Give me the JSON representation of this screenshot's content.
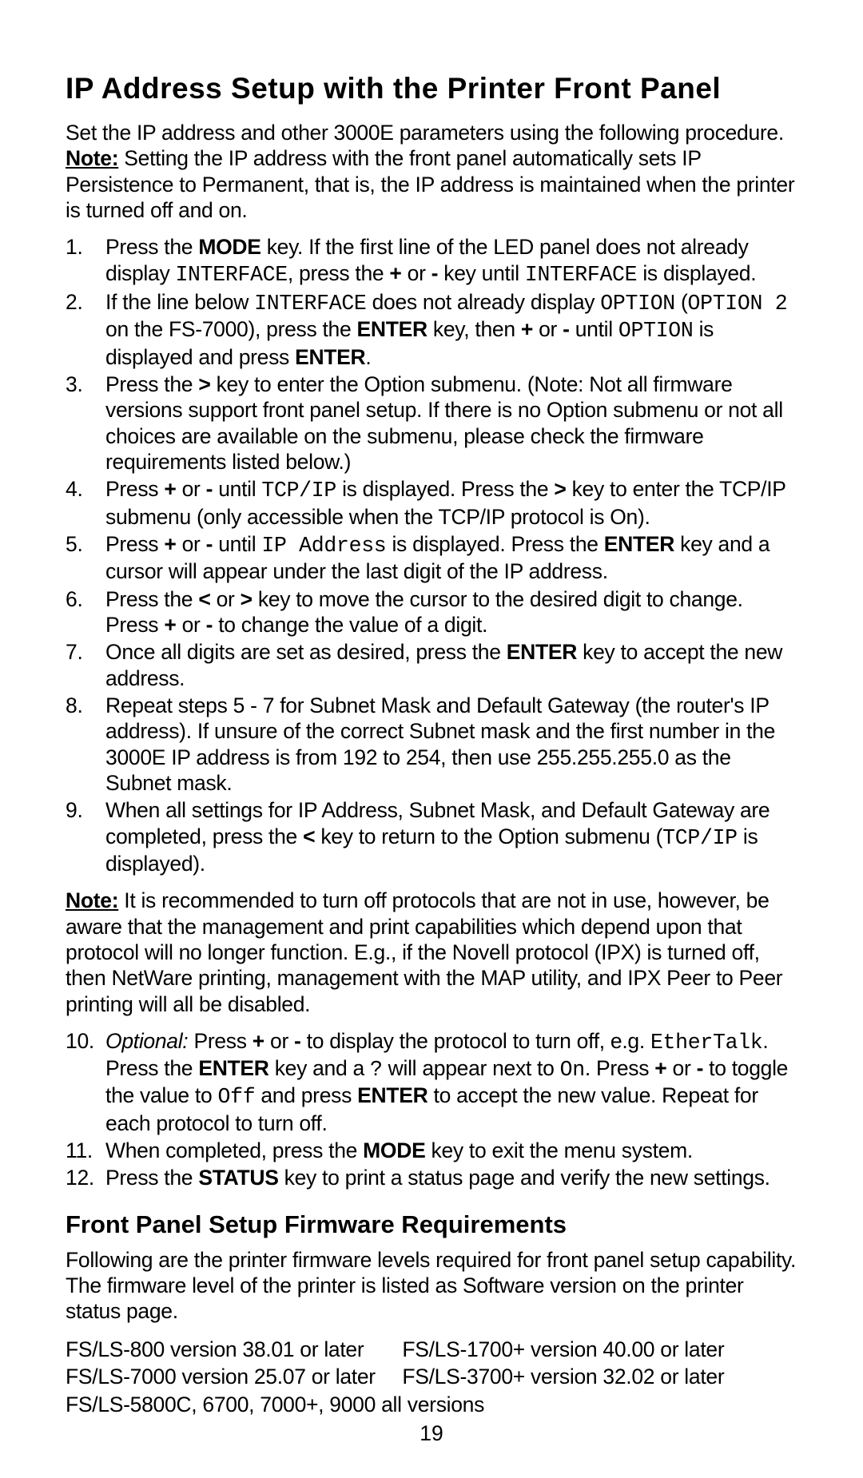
{
  "title": "IP Address Setup with the Printer Front Panel",
  "intro_line1": "Set the IP address and other 3000E parameters using the following procedure.",
  "intro_note_label": "Note:",
  "intro_note_text": " Setting the IP address with the front panel automatically sets IP Persistence to Permanent, that is, the IP address is maintained when the printer is turned off and on.",
  "step1_a": "Press the ",
  "step1_mode": "MODE",
  "step1_b": " key. If the first line of the LED panel does not already display ",
  "step1_interface1": "INTERFACE",
  "step1_c": ", press the ",
  "step1_plus": "+",
  "step1_d": " or ",
  "step1_minus": "-",
  "step1_e": " key until ",
  "step1_interface2": "INTERFACE",
  "step1_f": " is displayed.",
  "step2_a": "If the line below ",
  "step2_interface": "INTERFACE",
  "step2_b": " does not already display ",
  "step2_option1": "OPTION",
  "step2_c": " (",
  "step2_option2": "OPTION 2",
  "step2_d": " on the FS-7000), press the ",
  "step2_enter1": "ENTER",
  "step2_e": " key, then ",
  "step2_plus": "+",
  "step2_f": " or ",
  "step2_minus": "-",
  "step2_g": " until ",
  "step2_option3": "OPTION",
  "step2_h": " is displayed and press ",
  "step2_enter2": "ENTER",
  "step2_i": ".",
  "step3_a": "Press the ",
  "step3_gt": ">",
  "step3_b": " key to enter the Option submenu. (Note: Not all firmware versions support front panel setup. If there is no Option submenu or not all choices are available on the submenu, please check the firmware requirements listed below.)",
  "step4_a": "Press ",
  "step4_plus": "+",
  "step4_b": " or ",
  "step4_minus": "-",
  "step4_c": " until ",
  "step4_tcpip": "TCP/IP",
  "step4_d": " is displayed. Press the ",
  "step4_gt": ">",
  "step4_e": " key to enter the TCP/IP submenu (only accessible when the TCP/IP protocol is On).",
  "step5_a": "Press ",
  "step5_plus": "+",
  "step5_b": " or ",
  "step5_minus": "-",
  "step5_c": " until ",
  "step5_ipaddr": "IP Address",
  "step5_d": " is displayed. Press the ",
  "step5_enter": "ENTER",
  "step5_e": " key and a cursor will appear under the last digit of the IP address.",
  "step6_a": "Press the ",
  "step6_lt": "<",
  "step6_b": " or ",
  "step6_gt": ">",
  "step6_c": " key to move the cursor to the desired digit to change. Press ",
  "step6_plus": "+",
  "step6_d": " or ",
  "step6_minus": "-",
  "step6_e": " to change the value of a digit.",
  "step7_a": "Once all digits are set as desired, press the ",
  "step7_enter": "ENTER",
  "step7_b": " key to accept the new address.",
  "step8_a": "Repeat steps 5 - 7 for Subnet Mask and Default Gateway (the router's IP address). If unsure of the correct Subnet mask and the first number in the 3000E IP address is from 192 to 254, then use 255.255.255.0 as the Subnet mask.",
  "step9_a": "When all settings for IP Address, Subnet Mask, and Default Gateway are completed, press the ",
  "step9_lt": "<",
  "step9_b": " key to return to the Option submenu (",
  "step9_tcpip": "TCP/IP",
  "step9_c": " is displayed).",
  "mid_note_label": "Note:",
  "mid_note_text": " It is recommended to turn off protocols that are not in use, however, be aware that the management and print capabilities which depend upon that protocol will no longer function. E.g., if the Novell protocol (IPX) is turned off, then NetWare printing, management with the MAP utility, and IPX Peer to Peer printing will all be disabled.",
  "step10_opt": "Optional:",
  "step10_a": " Press ",
  "step10_plus": "+",
  "step10_b": " or ",
  "step10_minus": "-",
  "step10_c": " to display the protocol to turn off, e.g. ",
  "step10_ethertalk": "EtherTalk",
  "step10_d": ". Press the ",
  "step10_enter1": "ENTER",
  "step10_e": " key and a ",
  "step10_q": "?",
  "step10_f": " will appear next to ",
  "step10_on": "On",
  "step10_g": ". Press ",
  "step10_plus2": "+",
  "step10_h": " or ",
  "step10_minus2": "-",
  "step10_i": " to toggle the value to ",
  "step10_off": "Off",
  "step10_j": " and press ",
  "step10_enter2": "ENTER",
  "step10_k": " to accept the new value. Repeat for each protocol to turn off.",
  "step11_a": "When completed, press the ",
  "step11_mode": "MODE",
  "step11_b": " key to exit the menu system.",
  "step12_a": "Press the ",
  "step12_status": "STATUS",
  "step12_b": " key to print a status page and verify the new settings.",
  "firmware_heading": "Front Panel Setup Firmware Requirements",
  "firmware_intro": "Following are the printer firmware levels required for front panel setup capability. The firmware level of the printer is listed as Software version on the printer status page.",
  "fw_left1": "FS/LS-800 version 38.01 or later",
  "fw_right1": "FS/LS-1700+ version 40.00 or later",
  "fw_left2": "FS/LS-7000 version 25.07 or later",
  "fw_right2": "FS/LS-3700+ version 32.02 or later",
  "fw_full": "FS/LS-5800C, 6700, 7000+, 9000 all versions",
  "page_number": "19"
}
